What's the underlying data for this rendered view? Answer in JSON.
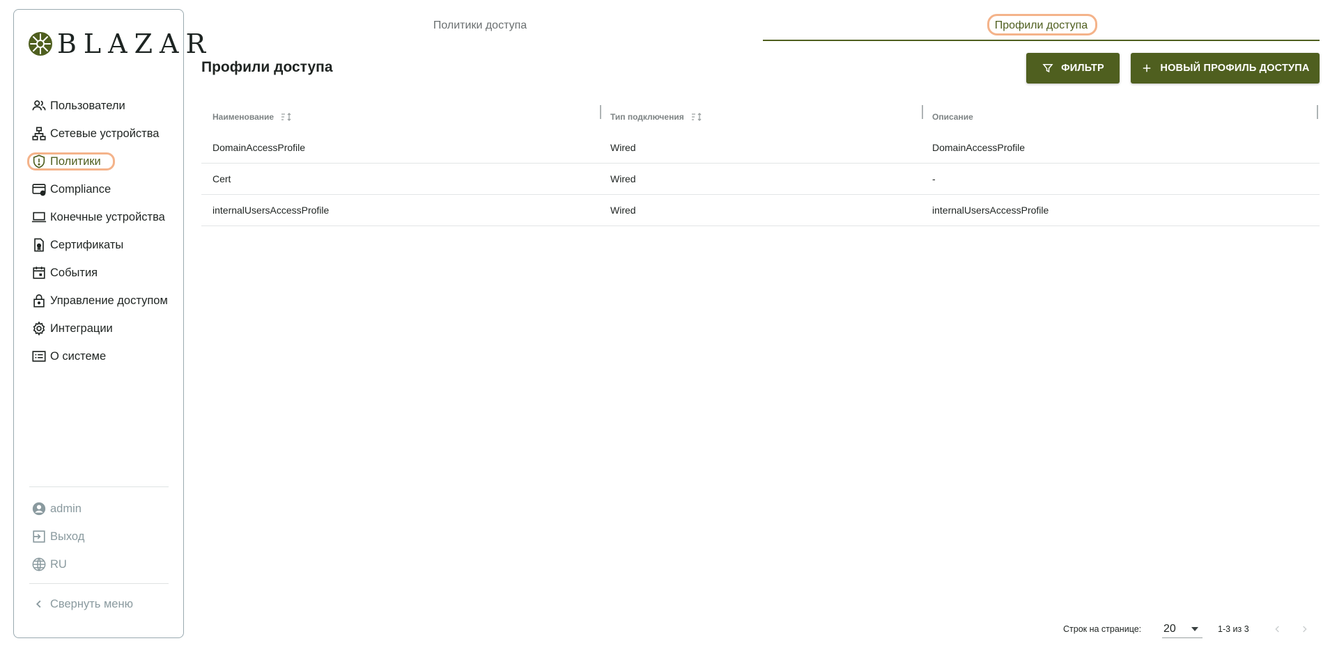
{
  "brand": {
    "name": "BLAZAR",
    "accent": "#4f5f1f",
    "highlight": "#f4b38a"
  },
  "sidebar": {
    "items": [
      {
        "label": "Пользователи",
        "icon": "users-icon"
      },
      {
        "label": "Сетевые устройства",
        "icon": "network-devices-icon"
      },
      {
        "label": "Политики",
        "icon": "shield-alert-icon",
        "active": true
      },
      {
        "label": "Compliance",
        "icon": "card-check-icon"
      },
      {
        "label": "Конечные устройства",
        "icon": "laptop-icon"
      },
      {
        "label": "Сертификаты",
        "icon": "certificate-icon"
      },
      {
        "label": "События",
        "icon": "calendar-icon"
      },
      {
        "label": "Управление доступом",
        "icon": "lock-icon"
      },
      {
        "label": "Интеграции",
        "icon": "gear-icon"
      },
      {
        "label": "О системе",
        "icon": "info-list-icon"
      }
    ],
    "user": {
      "label": "admin",
      "icon": "account-circle-icon"
    },
    "logout": {
      "label": "Выход",
      "icon": "logout-icon"
    },
    "language": {
      "label": "RU",
      "icon": "globe-icon"
    },
    "collapse": {
      "label": "Свернуть меню",
      "icon": "chevron-left-icon"
    }
  },
  "tabs": [
    {
      "label": "Политики доступа"
    },
    {
      "label": "Профили доступа",
      "active": true
    }
  ],
  "page": {
    "title": "Профили доступа",
    "filter_button": "ФИЛЬТР",
    "new_button": "НОВЫЙ ПРОФИЛЬ ДОСТУПА"
  },
  "table": {
    "columns": [
      {
        "label": "Наименование",
        "sortable": true
      },
      {
        "label": "Тип подключения",
        "sortable": true
      },
      {
        "label": "Описание",
        "sortable": false
      }
    ],
    "rows": [
      [
        "DomainAccessProfile",
        "Wired",
        "DomainAccessProfile"
      ],
      [
        "Cert",
        "Wired",
        "-"
      ],
      [
        "internalUsersAccessProfile",
        "Wired",
        "internalUsersAccessProfile"
      ]
    ]
  },
  "pagination": {
    "rows_per_page_label": "Строк на странице:",
    "rows_per_page": "20",
    "range": "1-3 из 3"
  }
}
